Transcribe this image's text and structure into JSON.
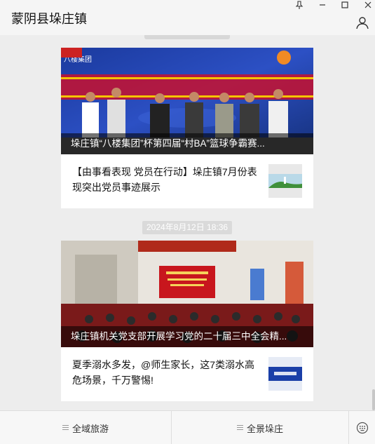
{
  "window": {
    "title": "蒙阴县垛庄镇",
    "controls": [
      "pin-icon",
      "minimize-icon",
      "maximize-icon",
      "close-icon"
    ]
  },
  "feed": {
    "card1": {
      "cover_caption": "垛庄镇“八楼集团”杯第四届“村BA”篮球争霸赛...",
      "banner_text": "八楼集团",
      "sub_item": {
        "text": "【由事看表现 党员在行动】垛庄镇7月份表现突出党员事迹展示"
      }
    },
    "timestamp": "2024年8月12日 18:36",
    "card2": {
      "cover_caption": "垛庄镇机关党支部开展学习党的二十届三中全会精...",
      "sub_item": {
        "text": "夏季溺水多发，@师生家长，这7类溺水高危场景，千万警惕!"
      }
    }
  },
  "bottom_menu": {
    "items": [
      {
        "label": "全域旅游",
        "icon": "menu-lines-icon"
      },
      {
        "label": "全景垛庄",
        "icon": "menu-lines-icon"
      }
    ],
    "keyboard_icon": "keyboard-icon"
  },
  "colors": {
    "background": "#ededed",
    "card": "#ffffff",
    "banner_red": "#c8102e",
    "photo_blue": "#1a3fa8"
  }
}
